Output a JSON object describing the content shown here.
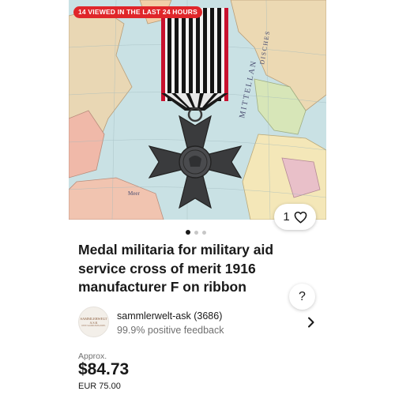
{
  "hero": {
    "badge": "14 VIEWED IN THE LAST 24 HOURS",
    "map_label_1": "MITTELLAN",
    "map_label_2": "DISCHES",
    "map_label_3": "Meer"
  },
  "like": {
    "count": "1",
    "icon": "heart-icon"
  },
  "carousel": {
    "total": 3,
    "active_index": 0
  },
  "listing": {
    "title": "Medal militaria for military aid service cross of merit 1916 manufacturer F on ribbon"
  },
  "help": {
    "label": "?"
  },
  "seller": {
    "avatar_line1": "SAMMLERWELT",
    "avatar_line2": "A.S.K",
    "avatar_line3": "DEIN SAMMLERHANDEL",
    "name": "sammlerwelt-ask (3686)",
    "feedback": "99.9% positive feedback",
    "chevron_icon": "chevron-right-icon"
  },
  "price": {
    "approx_label": "Approx.",
    "value": "$84.73",
    "original": "EUR 75.00"
  },
  "colors": {
    "badge": "#e0262a",
    "text": "#191919",
    "secondary_text": "#707070",
    "ribbon_red": "#c8102e"
  }
}
